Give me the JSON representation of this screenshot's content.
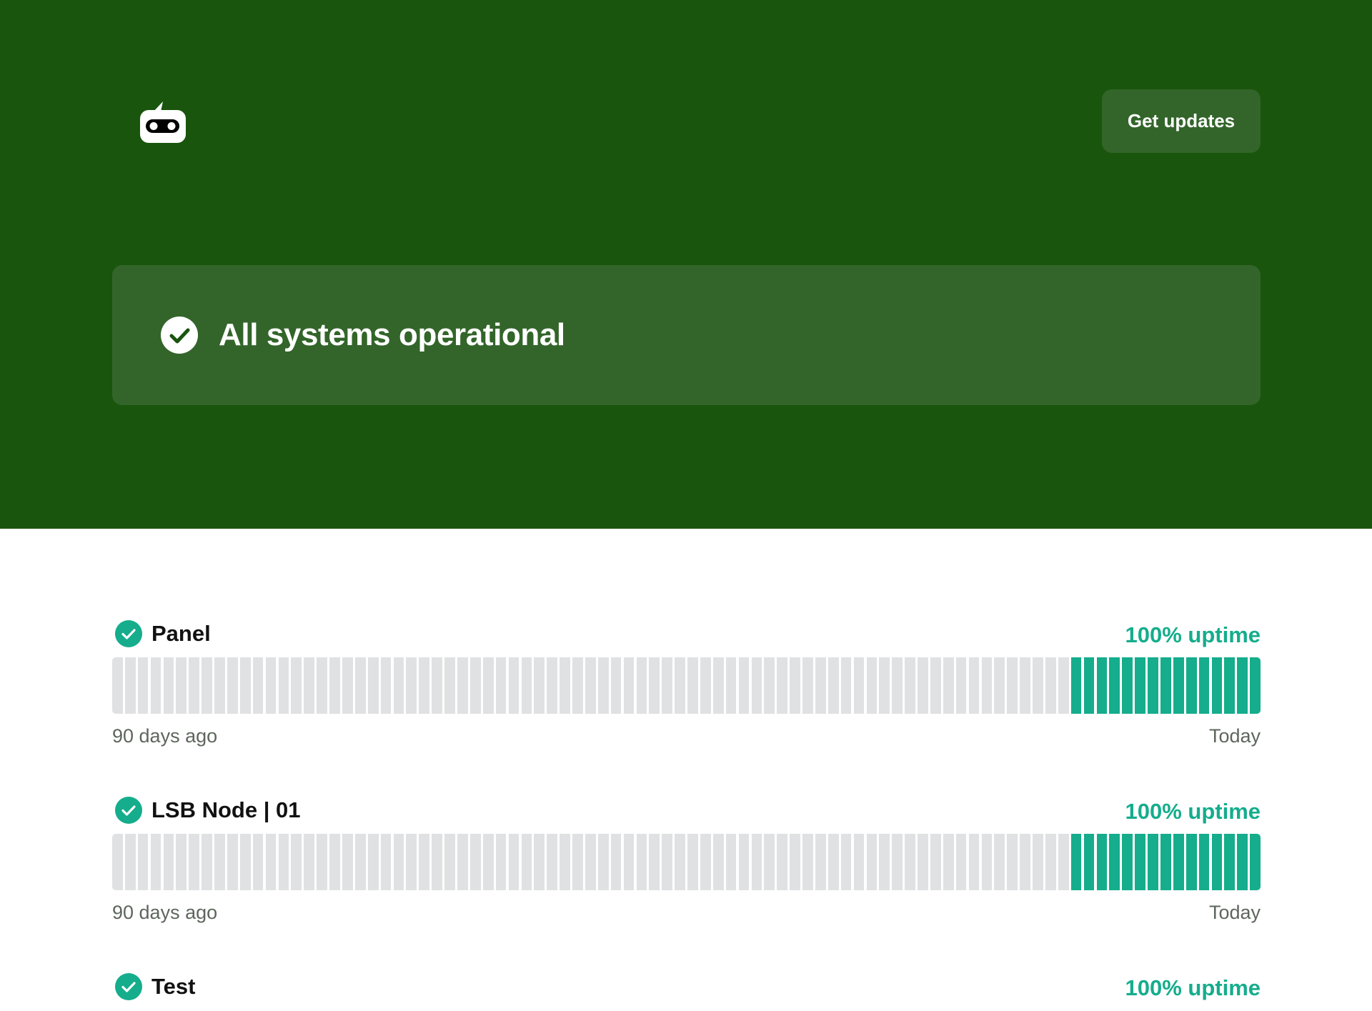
{
  "header": {
    "logo_icon": "robot-face-icon",
    "get_updates_label": "Get updates"
  },
  "status": {
    "icon": "check-circle-icon",
    "text": "All systems operational"
  },
  "colors": {
    "hero_background": "#19550d",
    "panel_background": "#33652a",
    "uptime_green": "#15ad8c",
    "bar_gray": "#e0e1e3"
  },
  "monitors": [
    {
      "name": "Panel",
      "uptime_label": "100% uptime",
      "range_start": "90 days ago",
      "range_end": "Today",
      "bars_total": 90,
      "bars_with_data": 15
    },
    {
      "name": "LSB Node | 01",
      "uptime_label": "100% uptime",
      "range_start": "90 days ago",
      "range_end": "Today",
      "bars_total": 90,
      "bars_with_data": 15
    },
    {
      "name": "Test",
      "uptime_label": "100% uptime"
    }
  ]
}
